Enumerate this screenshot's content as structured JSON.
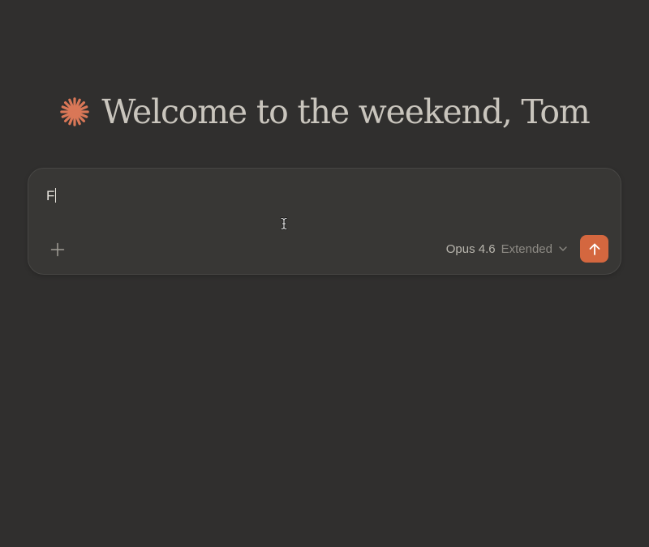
{
  "greeting": {
    "logo_icon": "sparkle-asterisk-icon",
    "text": "Welcome to the weekend, Tom"
  },
  "composer": {
    "input_value": "F",
    "add_icon": "plus-icon",
    "model": {
      "name": "Opus 4.6",
      "mode": "Extended",
      "chevron_icon": "chevron-down-icon"
    },
    "send_icon": "arrow-up-icon"
  },
  "colors": {
    "background": "#302f2e",
    "composer_background": "#383735",
    "accent": "#d4673f",
    "heading_text": "#c9c5bd"
  }
}
